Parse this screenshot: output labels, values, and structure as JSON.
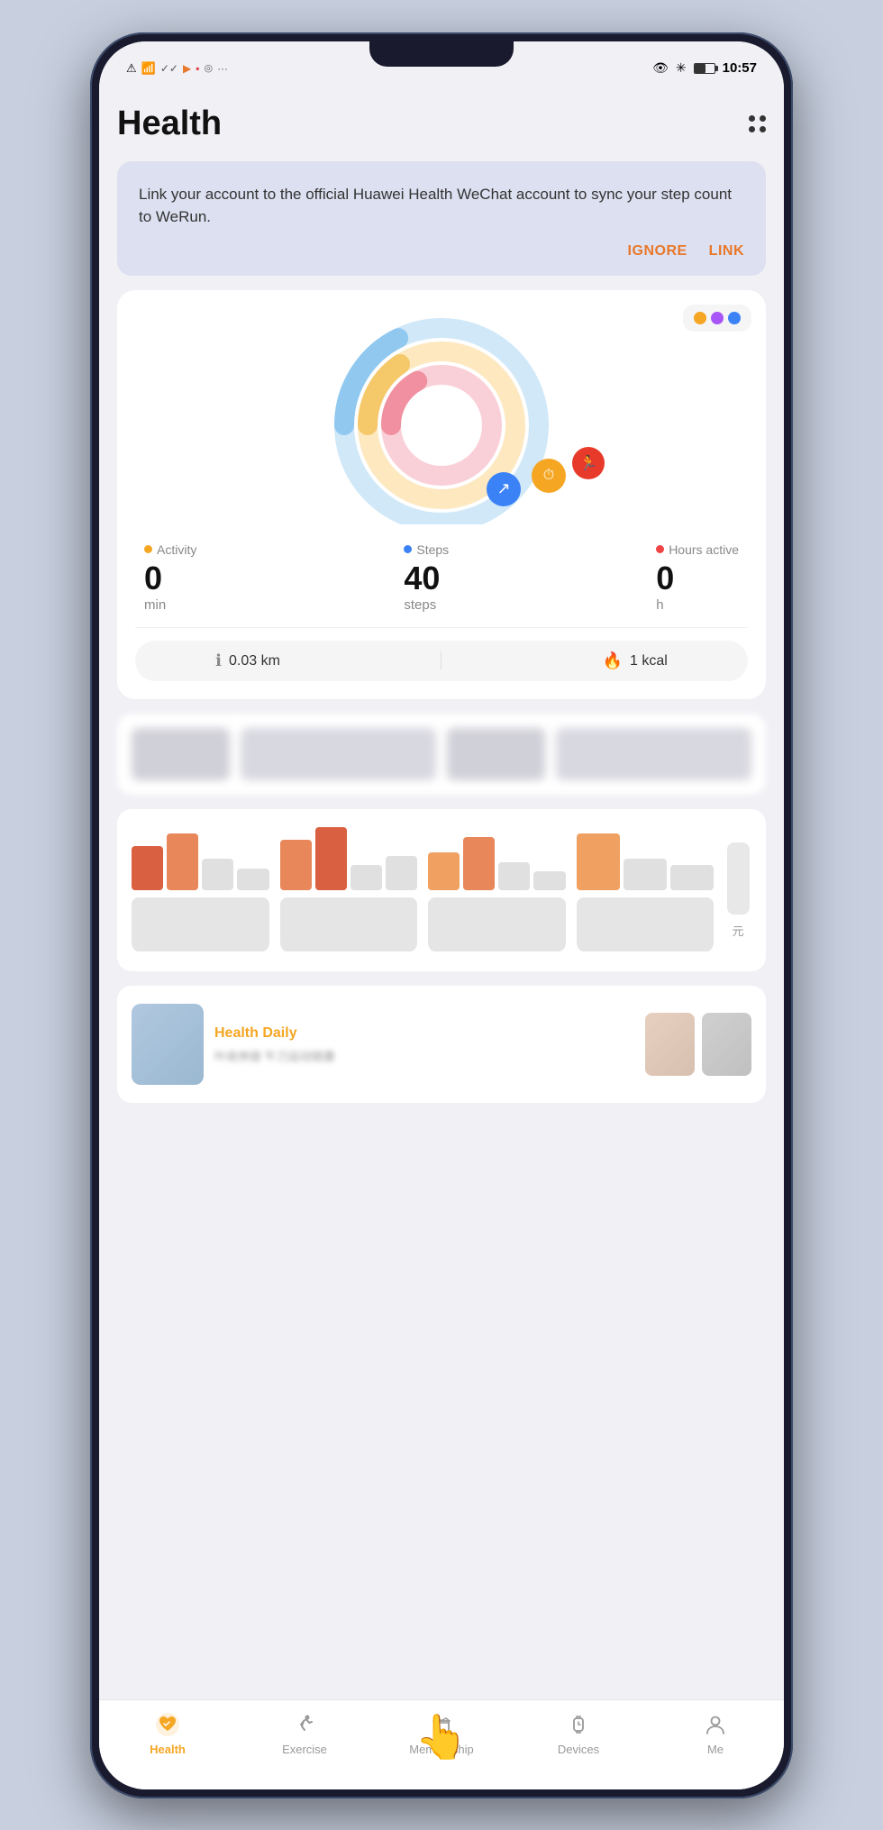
{
  "status_bar": {
    "time": "10:57",
    "left_icons": [
      "!",
      "wifi",
      "check",
      "check",
      "play",
      "square",
      "circles",
      "..."
    ],
    "right_icons": [
      "eye",
      "bluetooth",
      "battery"
    ]
  },
  "header": {
    "title": "Health",
    "menu_label": "more-menu"
  },
  "wechat_banner": {
    "text": "Link your account to the official Huawei Health WeChat account to sync your step count to WeRun.",
    "ignore_label": "IGNORE",
    "link_label": "LINK"
  },
  "activity_card": {
    "dots_icon_label": "apps-icon",
    "stats": [
      {
        "label": "Activity",
        "dot_color": "orange",
        "value": "0",
        "unit": "min"
      },
      {
        "label": "Steps",
        "dot_color": "blue",
        "value": "40",
        "unit": "steps"
      },
      {
        "label": "Hours active",
        "dot_color": "red",
        "value": "0",
        "unit": "h"
      }
    ],
    "distance": "0.03 km",
    "calories": "1 kcal"
  },
  "bottom_nav": {
    "items": [
      {
        "id": "health",
        "label": "Health",
        "active": true
      },
      {
        "id": "exercise",
        "label": "Exercise",
        "active": false
      },
      {
        "id": "membership",
        "label": "Membership",
        "active": false
      },
      {
        "id": "devices",
        "label": "Devices",
        "active": false
      },
      {
        "id": "me",
        "label": "Me",
        "active": false
      }
    ]
  },
  "health_daily": {
    "label": "Health Daily",
    "subtitle": "叶收休链 午刀运动链康"
  }
}
